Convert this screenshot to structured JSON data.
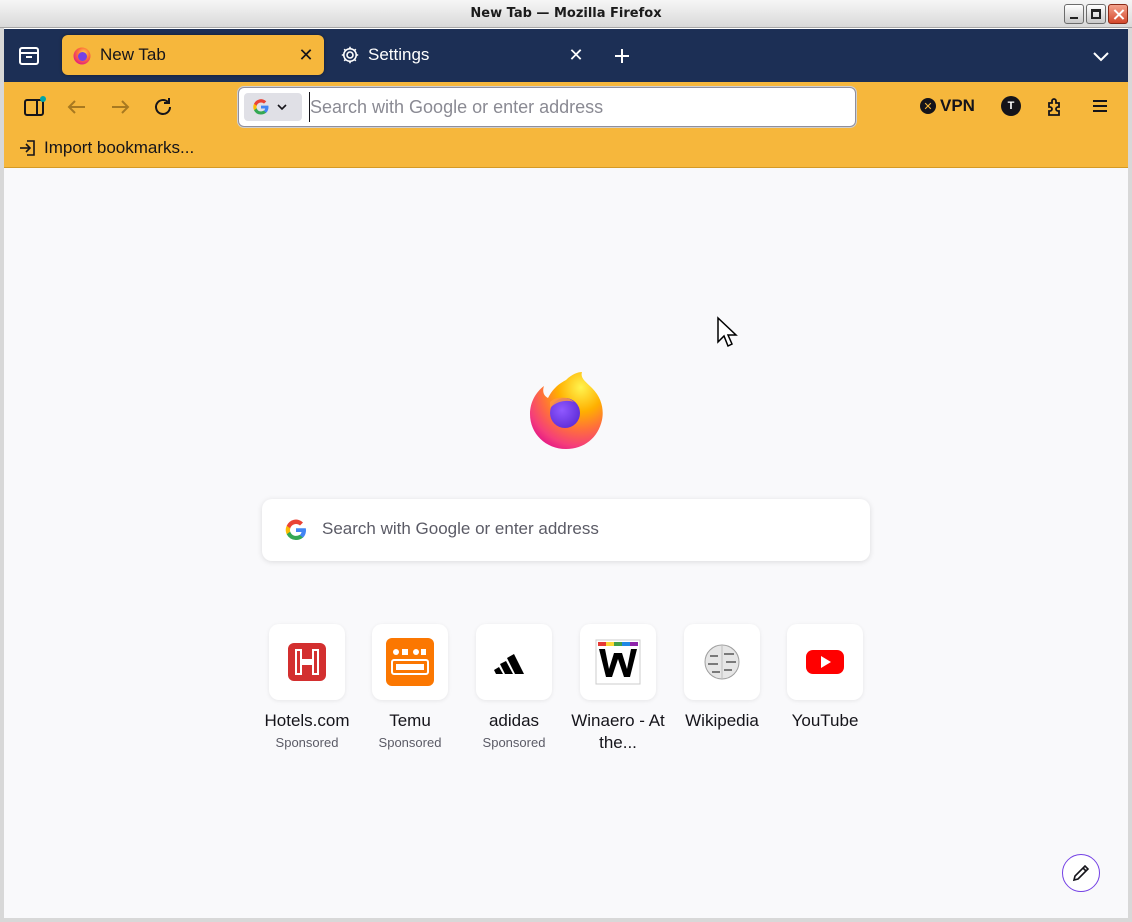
{
  "window": {
    "title": "New Tab — Mozilla Firefox"
  },
  "tabs": [
    {
      "label": "New Tab",
      "active": true,
      "icon": "firefox-icon"
    },
    {
      "label": "Settings",
      "active": false,
      "icon": "gear-icon"
    }
  ],
  "toolbar": {
    "urlbar_placeholder": "Search with Google or enter address",
    "vpn_label": "VPN",
    "account_initial": "T"
  },
  "bookmarks": {
    "import_label": "Import bookmarks..."
  },
  "newtab": {
    "search_placeholder": "Search with Google or enter address",
    "top_sites": [
      {
        "name": "Hotels.com",
        "sponsored": "Sponsored",
        "icon": "hotels-icon"
      },
      {
        "name": "Temu",
        "sponsored": "Sponsored",
        "icon": "temu-icon"
      },
      {
        "name": "adidas",
        "sponsored": "Sponsored",
        "icon": "adidas-icon"
      },
      {
        "name": "Winaero - At the...",
        "sponsored": "",
        "icon": "winaero-icon"
      },
      {
        "name": "Wikipedia",
        "sponsored": "",
        "icon": "wikipedia-icon"
      },
      {
        "name": "YouTube",
        "sponsored": "",
        "icon": "youtube-icon"
      }
    ]
  },
  "colors": {
    "tabstrip": "#1c2f55",
    "toolbar": "#f6b73c",
    "content": "#f9f9fb",
    "accent": "#7542e5"
  }
}
